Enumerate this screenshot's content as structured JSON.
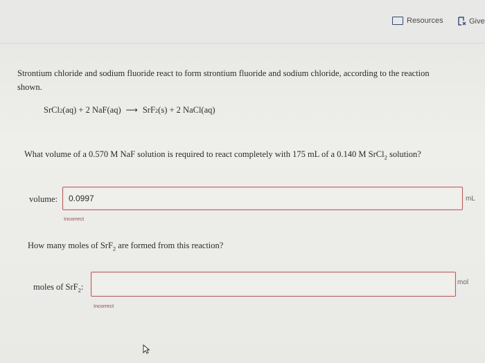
{
  "toolbar": {
    "resources_label": "Resources",
    "give_label": "Give"
  },
  "intro": "Strontium chloride and sodium fluoride react to form strontium fluoride and sodium chloride, according to the reaction shown.",
  "equation": {
    "r1": "SrCl",
    "r1_sub": "2",
    "r1_state": "(aq) + 2 NaF(aq)",
    "arrow": "⟶",
    "p1": "SrF",
    "p1_sub": "2",
    "p1_state": "(s) + 2 NaCl(aq)"
  },
  "question1": {
    "pre": "What volume of a 0.570 M NaF solution is required to react completely with 175 mL of a 0.140 M SrCl",
    "sub": "2",
    "post": " solution?",
    "label": "volume:",
    "value": "0.0997",
    "unit": "mL",
    "feedback": "Incorrect"
  },
  "question2": {
    "pre": "How many moles of SrF",
    "sub": "2",
    "post": " are formed from this reaction?",
    "label_pre": "moles of SrF",
    "label_sub": "2",
    "label_post": ":",
    "value": "",
    "unit": "mol",
    "feedback": "Incorrect"
  },
  "colors": {
    "field_border": "#b15a57",
    "icon": "#2f4a78"
  }
}
